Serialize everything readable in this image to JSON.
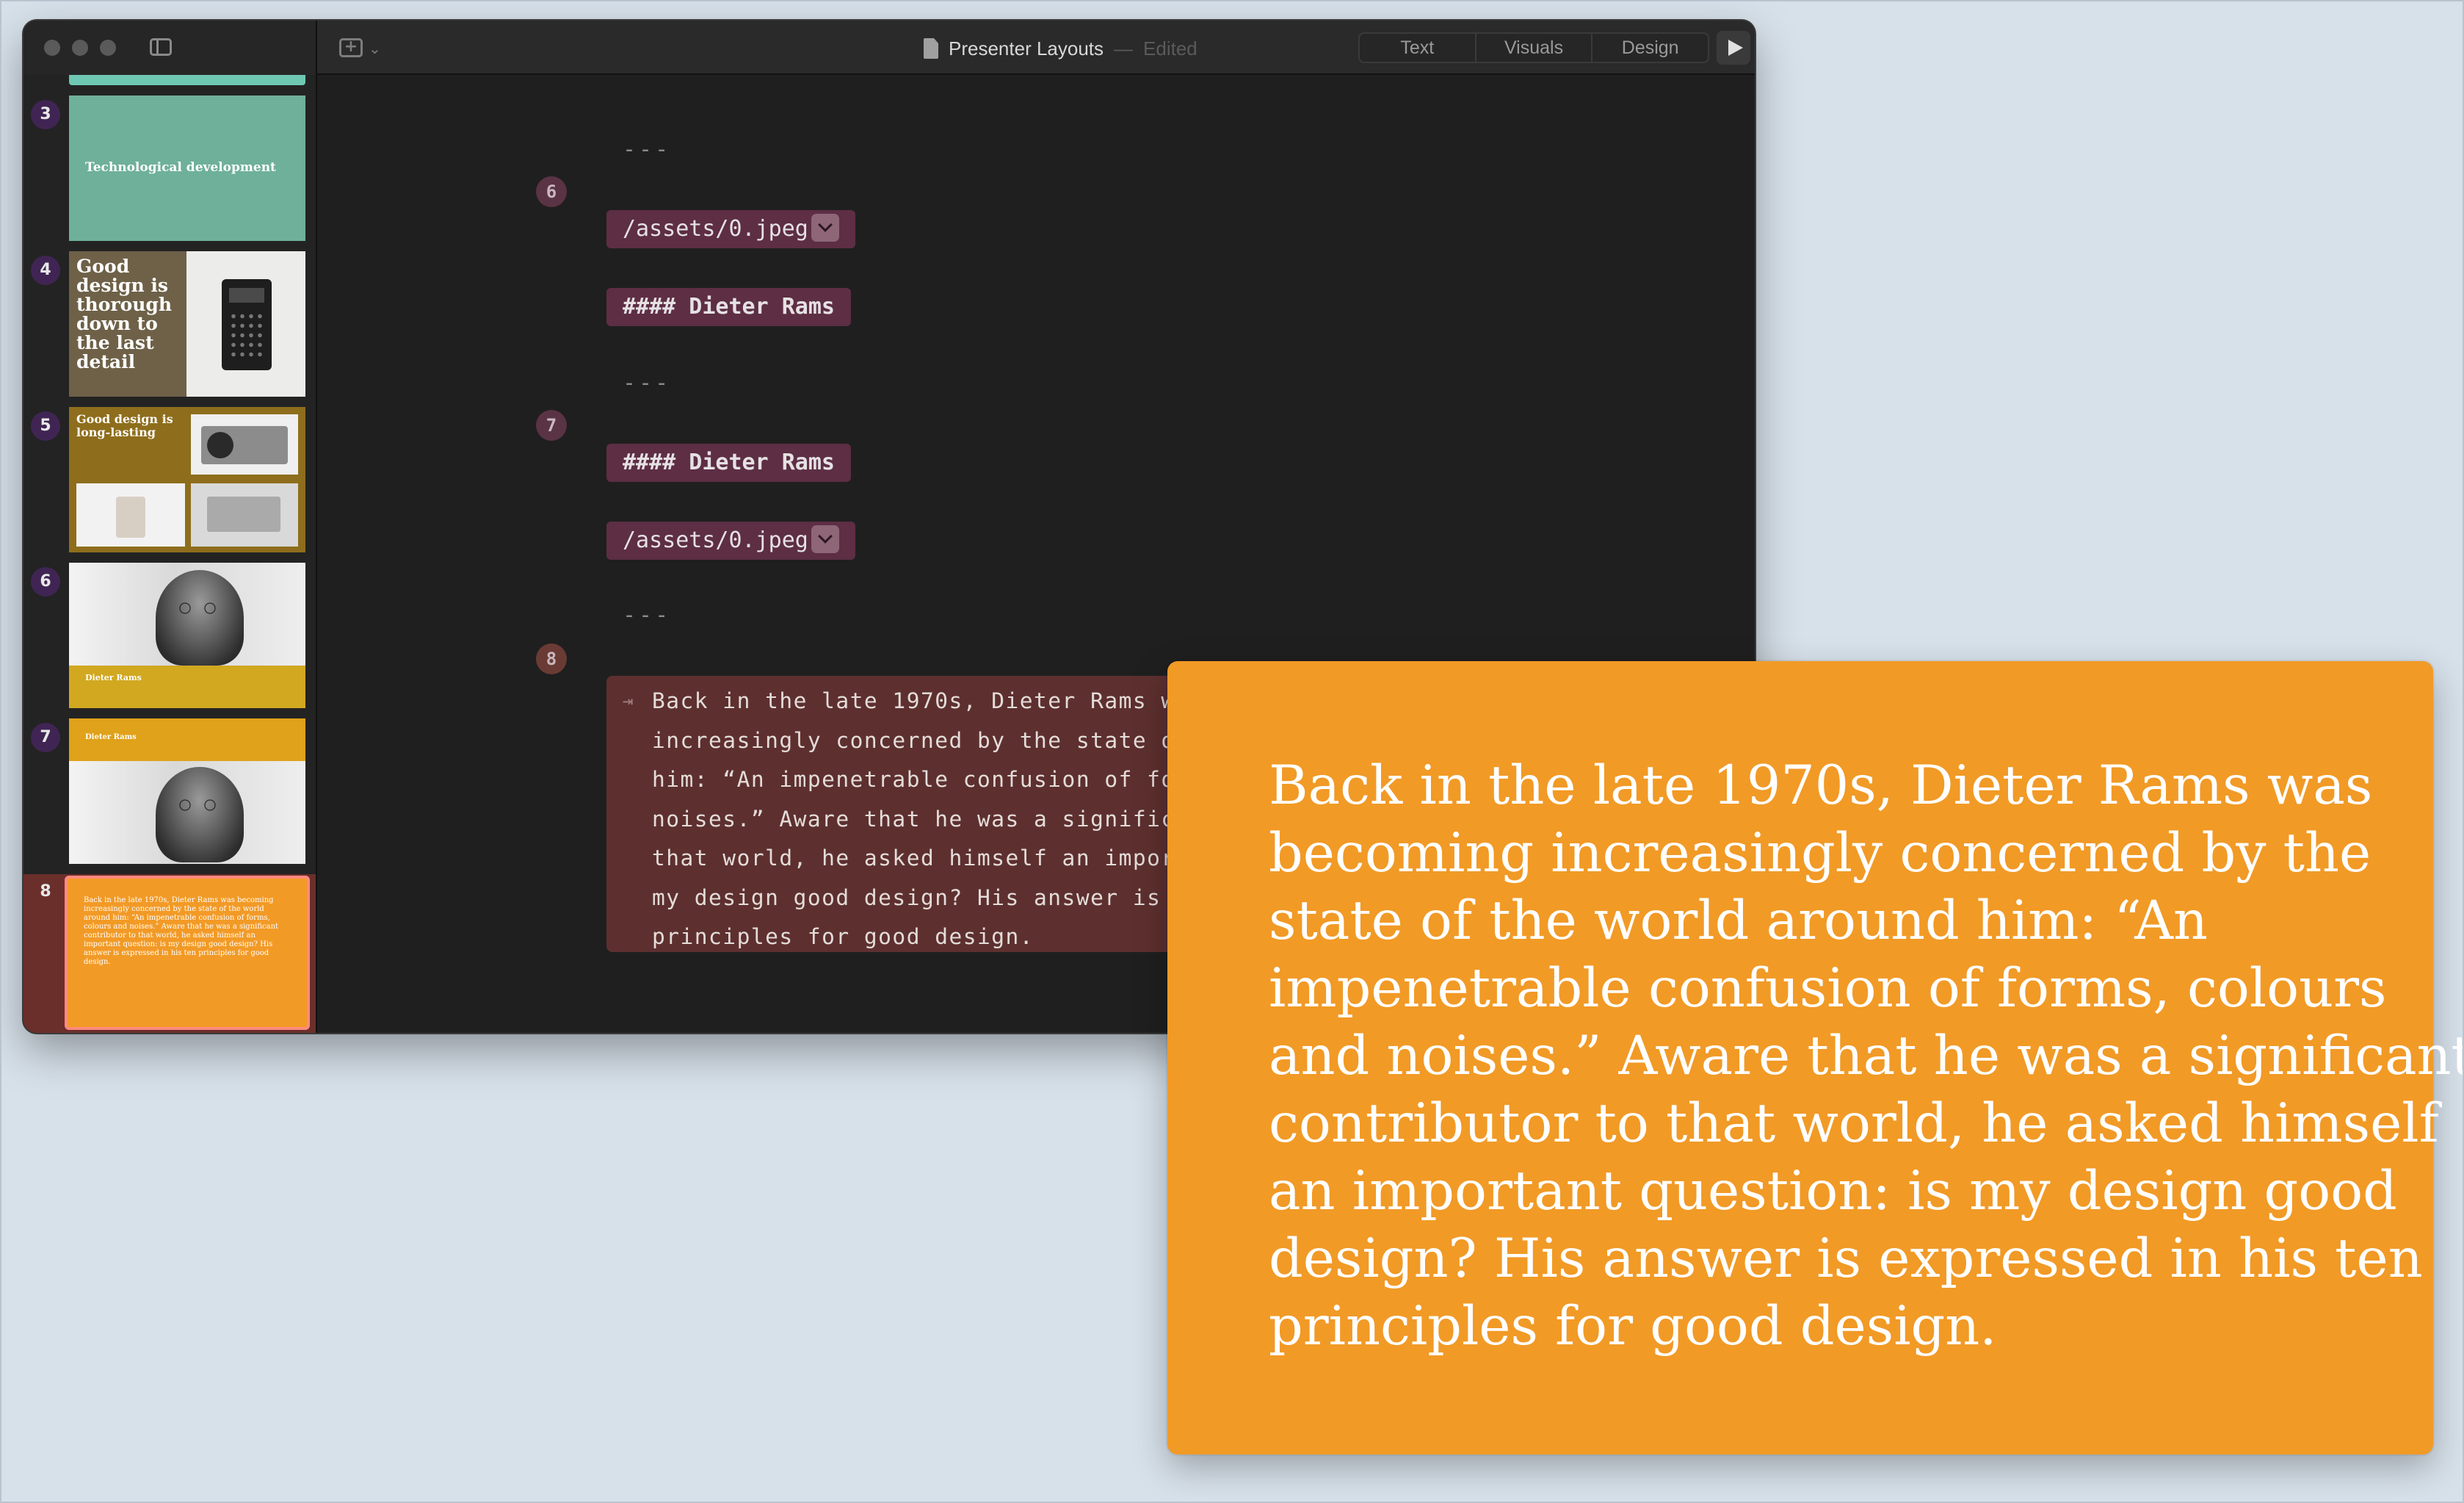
{
  "window": {
    "document_title": "Presenter Layouts",
    "title_dash": "—",
    "edit_status": "Edited",
    "modes": [
      "Text",
      "Visuals",
      "Design"
    ]
  },
  "sidebar": {
    "slides": [
      {
        "number": "3",
        "title": "Technological development"
      },
      {
        "number": "4",
        "title": "Good design is thorough down to the last detail"
      },
      {
        "number": "5",
        "title": "Good design is long-lasting"
      },
      {
        "number": "6",
        "title": "Dieter Rams"
      },
      {
        "number": "7",
        "title": "Dieter Rams"
      },
      {
        "number": "8",
        "title": "Back in the late 1970s, Dieter Rams was becoming increasingly concerned by the state of the world around him: “An impenetrable confusion of forms, colours and noises.” Aware that he was a significant contributor to that world, he asked himself an important question: is my design good design? His answer is expressed in his ten principles for good design."
      }
    ]
  },
  "editor": {
    "separator": "---",
    "markers": [
      "6",
      "7",
      "8"
    ],
    "image_path": "/assets/0.jpeg",
    "heading": "#### Dieter Rams",
    "text_block_arrow": "⇥",
    "text_block": "Back in the late 1970s, Dieter Rams was becoming\nincreasingly concerned by the state of the world around\nhim: “An impenetrable confusion of forms, colours and\nnoises.” Aware that he was a significant contributor to\nthat world, he asked himself an important question: is\nmy design good design? His answer is expressed in his ten\nprinciples for good design."
  },
  "presenter": {
    "text": "Back in the late 1970s, Dieter Rams was\nbecoming increasingly concerned by the\nstate of the world around him: “An\nimpenetrable confusion of forms, colours\nand noises.” Aware that he was a significant\ncontributor to that world, he asked himself\nan important question: is my design good\ndesign? His answer is expressed in his ten\nprinciples for good design."
  },
  "colors": {
    "window_bg": "#1f1f1f",
    "chip_bg": "#5d2e44",
    "text_block_bg": "#5d302f",
    "presenter_bg": "#f19a26",
    "desktop_bg": "#d7e1ea"
  }
}
